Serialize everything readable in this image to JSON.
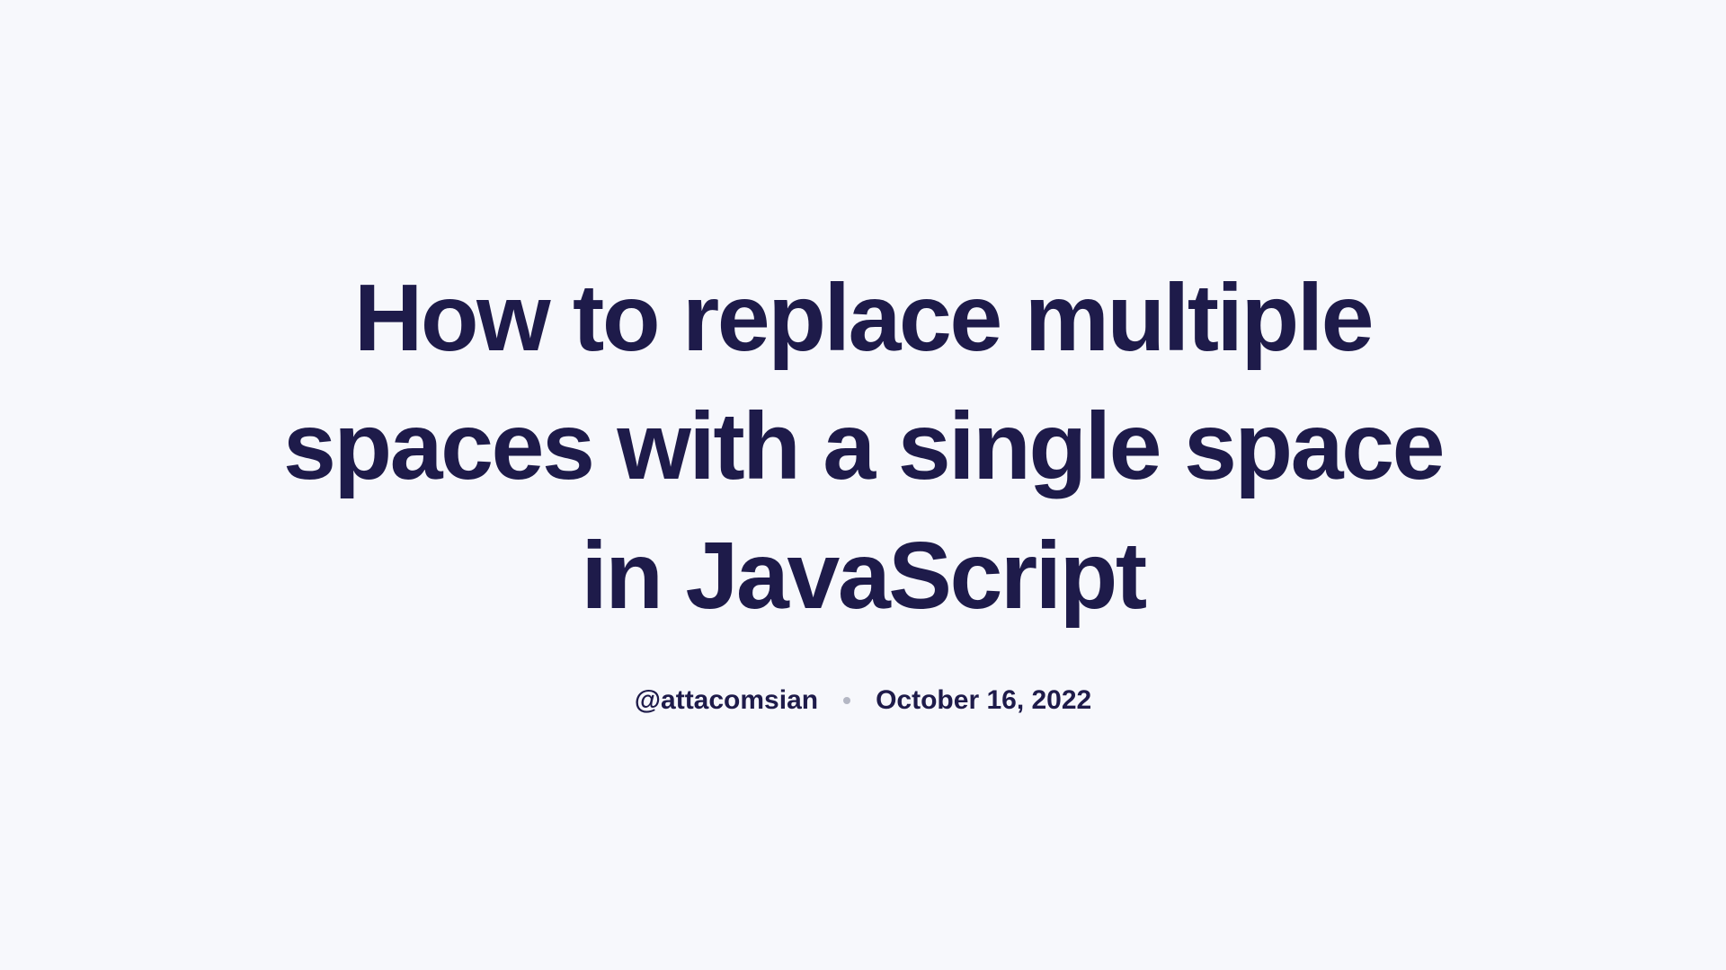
{
  "article": {
    "title": "How to replace multiple spaces with a single space in JavaScript",
    "author": "@attacomsian",
    "date": "October 16, 2022"
  }
}
